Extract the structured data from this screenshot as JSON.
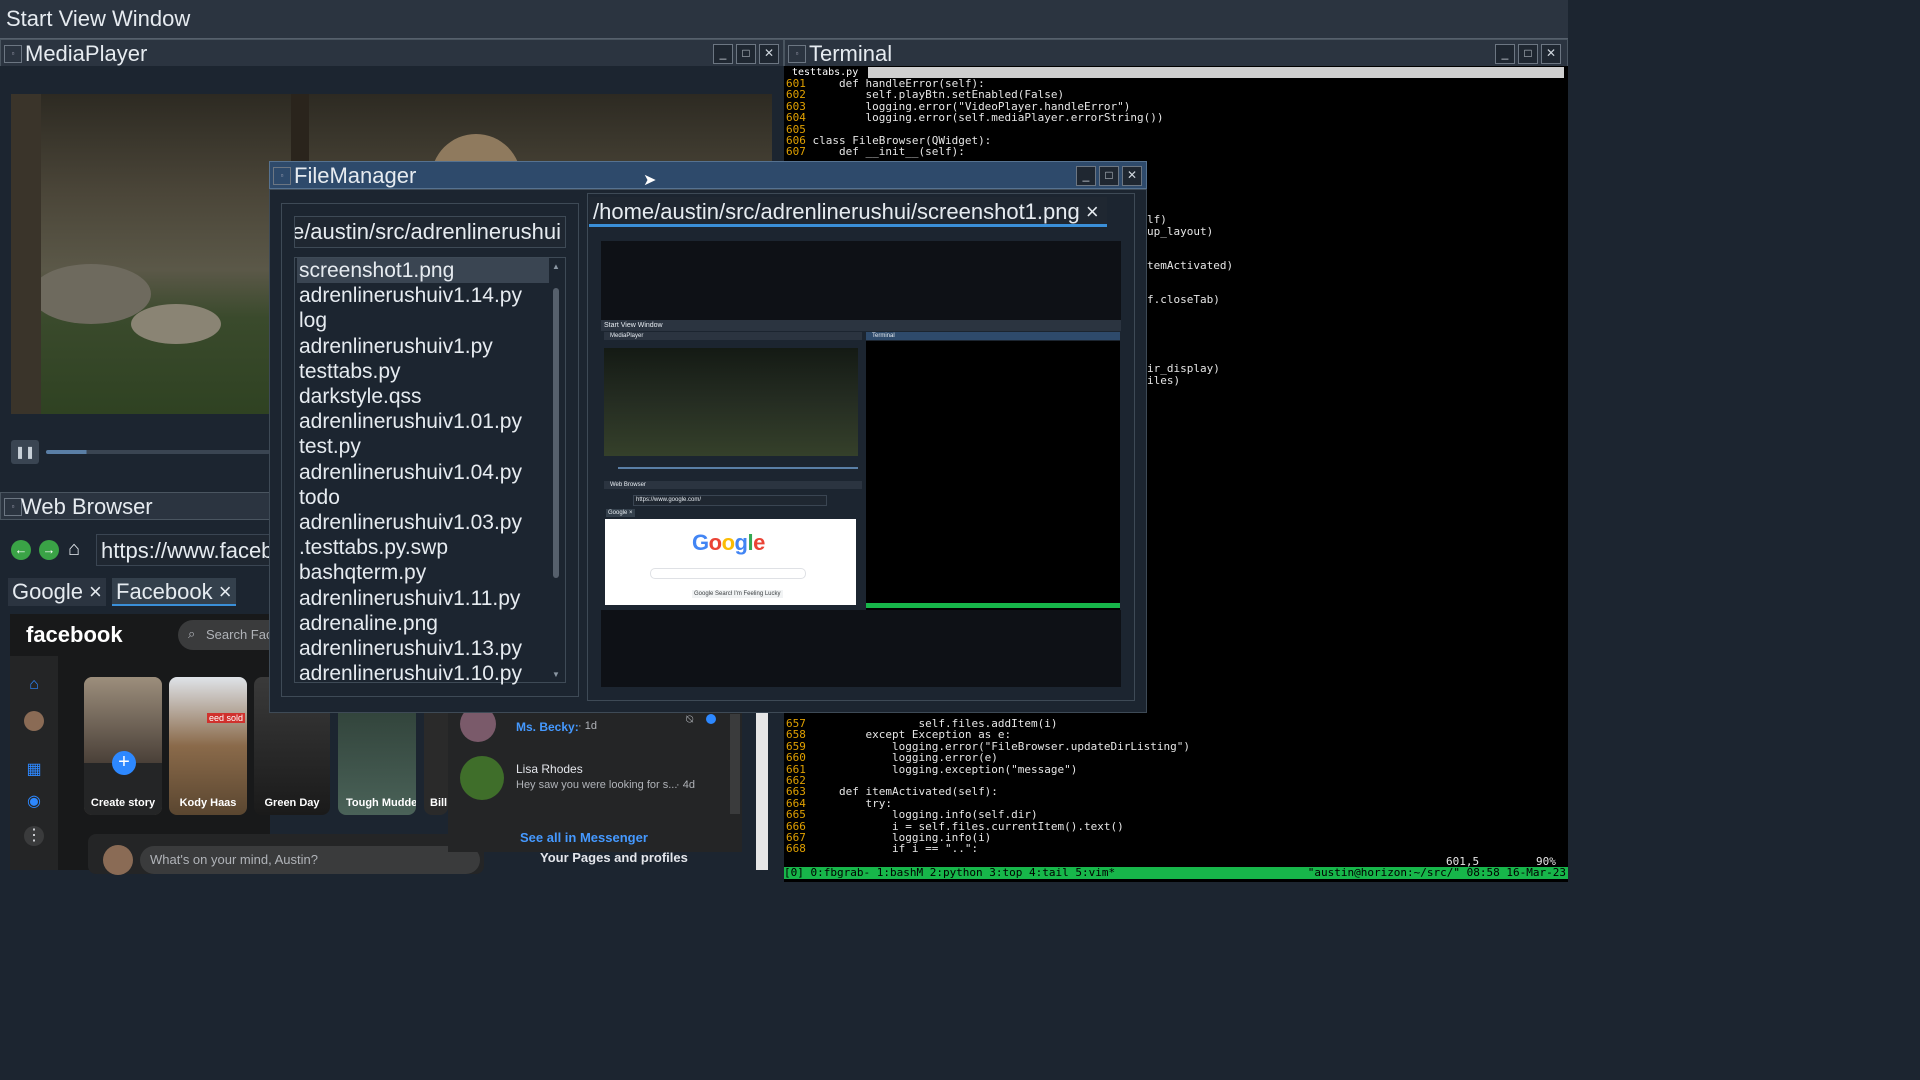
{
  "top_window": {
    "title": "Start View Window"
  },
  "media_player": {
    "title": "MediaPlayer",
    "progress": 0.18
  },
  "web_browser": {
    "title": "Web Browser",
    "url": "https://www.faceb",
    "tabs": [
      {
        "label": "Google ×"
      },
      {
        "label": "Facebook ×"
      }
    ]
  },
  "facebook": {
    "logo": "facebook",
    "search_placeholder": "Search Fac",
    "stories": [
      {
        "name": "Create story"
      },
      {
        "name": "Kody Haas",
        "badge": "eed sold"
      },
      {
        "name": "Green Day"
      },
      {
        "name": "Tough Mudder"
      },
      {
        "name": "Bill"
      }
    ],
    "post_placeholder": "What's on your mind, Austin?",
    "pages_label": "Your Pages and profiles",
    "messages": [
      {
        "name": "Ms. Becky:",
        "time": "· 1d"
      },
      {
        "name": "Lisa Rhodes",
        "text": "Hey saw you were looking for s...",
        "time": "· 4d"
      }
    ],
    "see_all": "See all in Messenger"
  },
  "terminal": {
    "title": "Terminal",
    "tab": "testtabs.py",
    "lines_top": [
      {
        "n": "601",
        "code": "    def handleError(self):"
      },
      {
        "n": "602",
        "code": "        self.playBtn.setEnabled(False)"
      },
      {
        "n": "603",
        "code": "        logging.error(\"VideoPlayer.handleError\")"
      },
      {
        "n": "604",
        "code": "        logging.error(self.mediaPlayer.errorString())"
      },
      {
        "n": "605",
        "code": ""
      },
      {
        "n": "606",
        "code": "class FileBrowser(QWidget):"
      },
      {
        "n": "607",
        "code": "    def __init__(self):"
      }
    ],
    "right_fragments": [
      "lf)",
      "up_layout)",
      "temActivated)",
      "f.closeTab)",
      "ir_display)",
      "iles)"
    ],
    "lines_bottom": [
      {
        "n": "657",
        "code": "                self.files.addItem(i)"
      },
      {
        "n": "658",
        "code": "        except Exception as e:"
      },
      {
        "n": "659",
        "code": "            logging.error(\"FileBrowser.updateDirListing\")"
      },
      {
        "n": "660",
        "code": "            logging.error(e)"
      },
      {
        "n": "661",
        "code": "            logging.exception(\"message\")"
      },
      {
        "n": "662",
        "code": ""
      },
      {
        "n": "663",
        "code": "    def itemActivated(self):"
      },
      {
        "n": "664",
        "code": "        try:"
      },
      {
        "n": "665",
        "code": "            logging.info(self.dir)"
      },
      {
        "n": "666",
        "code": "            i = self.files.currentItem().text()"
      },
      {
        "n": "667",
        "code": "            logging.info(i)"
      },
      {
        "n": "668",
        "code": "            if i == \"..\":"
      }
    ],
    "cursor_pos": "601,5",
    "percent": "90%",
    "status": "[0] 0:fbgrab- 1:bashM 2:python  3:top  4:tail  5:vim*",
    "status_right": "\"austin@horizon:~/src/\" 08:58 16-Mar-23"
  },
  "file_manager": {
    "title": "FileManager",
    "path": "/home/austin/src/adrenlinerushui",
    "files": [
      "screenshot1.png",
      "adrenlinerushuiv1.14.py",
      "log",
      "adrenlinerushuiv1.py",
      "testtabs.py",
      "darkstyle.qss",
      "adrenlinerushuiv1.01.py",
      "test.py",
      "adrenlinerushuiv1.04.py",
      "todo",
      "adrenlinerushuiv1.03.py",
      ".testtabs.py.swp",
      "bashqterm.py",
      "adrenlinerushuiv1.11.py",
      "adrenaline.png",
      "adrenlinerushuiv1.13.py",
      "adrenlinerushuiv1.10.py"
    ],
    "open_tab": "/home/austin/src/adrenlinerushui/screenshot1.png ×",
    "preview": {
      "title": "Start View Window",
      "mp_title": "MediaPlayer",
      "term_title": "Terminal",
      "wb_title": "Web Browser",
      "url": "https://www.google.com/",
      "tab": "Google ×",
      "google": "Google",
      "btn1": "Google Search",
      "btn2": "I'm Feeling Lucky"
    }
  }
}
